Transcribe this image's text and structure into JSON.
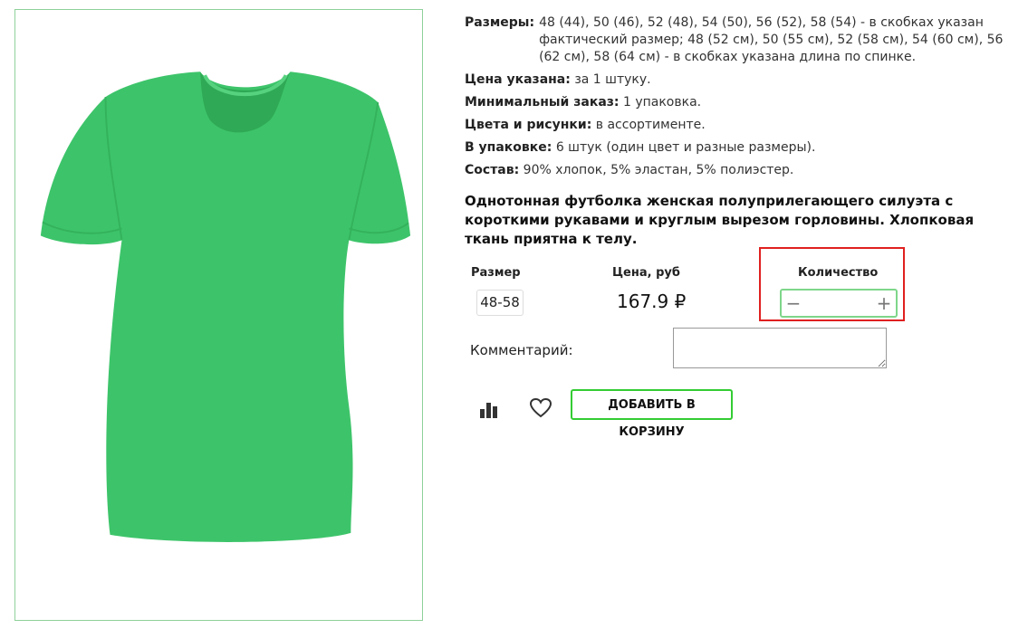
{
  "product": {
    "image_alt": "green t-shirt",
    "colors": {
      "shirt": "#3dc46a",
      "shirt_dark": "#2fa955",
      "frame": "#8fd19b",
      "accent": "#33cc33",
      "highlight": "#e02020"
    }
  },
  "specs": {
    "sizes_label": "Размеры:",
    "sizes_value": "48 (44), 50 (46), 52 (48), 54 (50), 56 (52), 58 (54) - в скобках указан фактический размер; 48 (52 см), 50 (55 см), 52 (58 см), 54 (60 см), 56 (62 см), 58 (64 см) - в скобках указана длина по спинке.",
    "price_label": "Цена указана:",
    "price_value": "за 1 штуку.",
    "min_order_label": "Минимальный заказ:",
    "min_order_value": "1 упаковка.",
    "colors_label": "Цвета и рисунки:",
    "colors_value": "в ассортименте.",
    "package_label": "В упаковке:",
    "package_value": "6 штук (один цвет и разные размеры).",
    "composition_label": "Состав:",
    "composition_value": "90% хлопок, 5% эластан, 5% полиэстер."
  },
  "description": "Однотонная футболка женская полуприлегающего силуэта с короткими рукавами и круглым вырезом горловины. Хлопковая ткань приятна к телу.",
  "order": {
    "size_header": "Размер",
    "price_header": "Цена, руб",
    "qty_header": "Количество",
    "size_value": "48-58",
    "price_value": "167.9 ₽",
    "qty_minus": "−",
    "qty_plus": "+",
    "qty_value": ""
  },
  "comment": {
    "label": "Комментарий:",
    "value": ""
  },
  "actions": {
    "stats_icon": "bar-chart-icon",
    "fav_icon": "heart-icon",
    "add_to_cart": "ДОБАВИТЬ В КОРЗИНУ"
  }
}
